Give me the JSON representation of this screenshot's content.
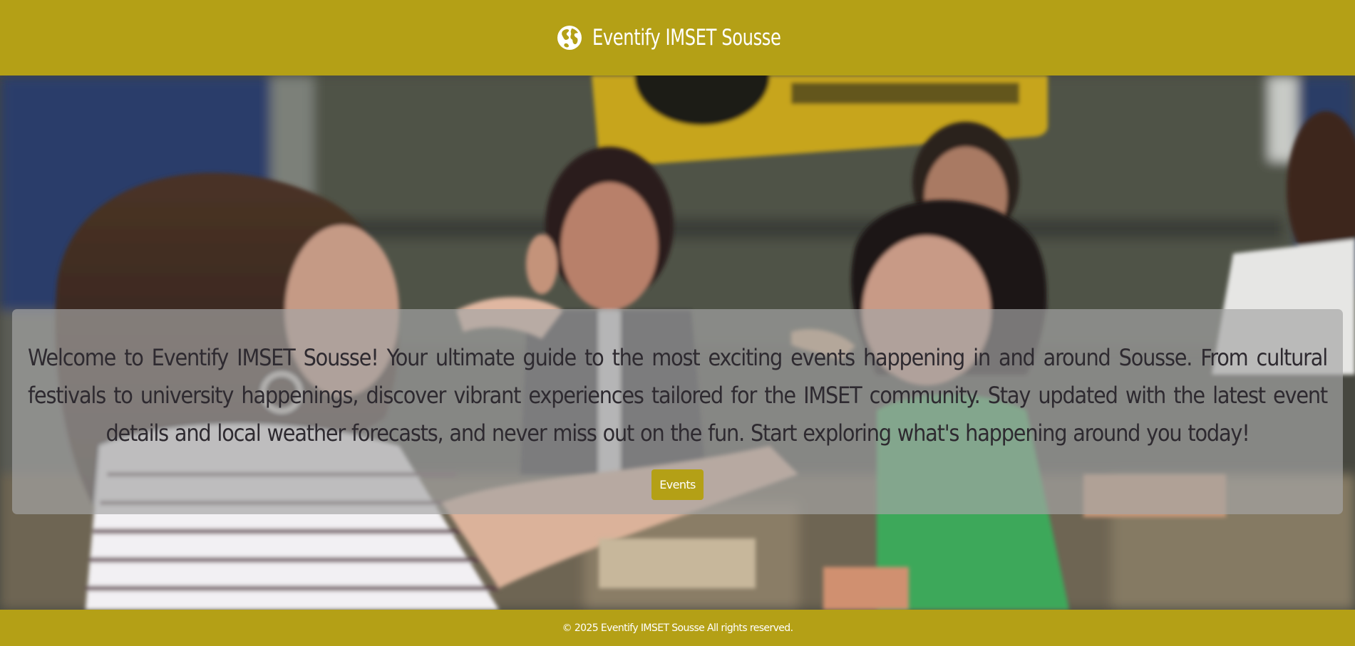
{
  "header": {
    "title": "Eventify IMSET Sousse",
    "icon": "globe-icon"
  },
  "hero": {
    "background": "photo of students eating pizza",
    "welcome_text": "Welcome to Eventify IMSET Sousse! Your ultimate guide to the most exciting events happening in and around Sousse. From cultural festivals to university happenings, discover vibrant experiences tailored for the IMSET community. Stay updated with the latest event details and local weather forecasts, and never miss out on the fun. Start exploring what's happening around you today!",
    "button_label": "Events"
  },
  "footer": {
    "text": "© 2025 Eventify IMSET Sousse All rights reserved."
  },
  "colors": {
    "brand": "#b4a016",
    "text_dark": "#2e2a30",
    "white": "#ffffff"
  }
}
